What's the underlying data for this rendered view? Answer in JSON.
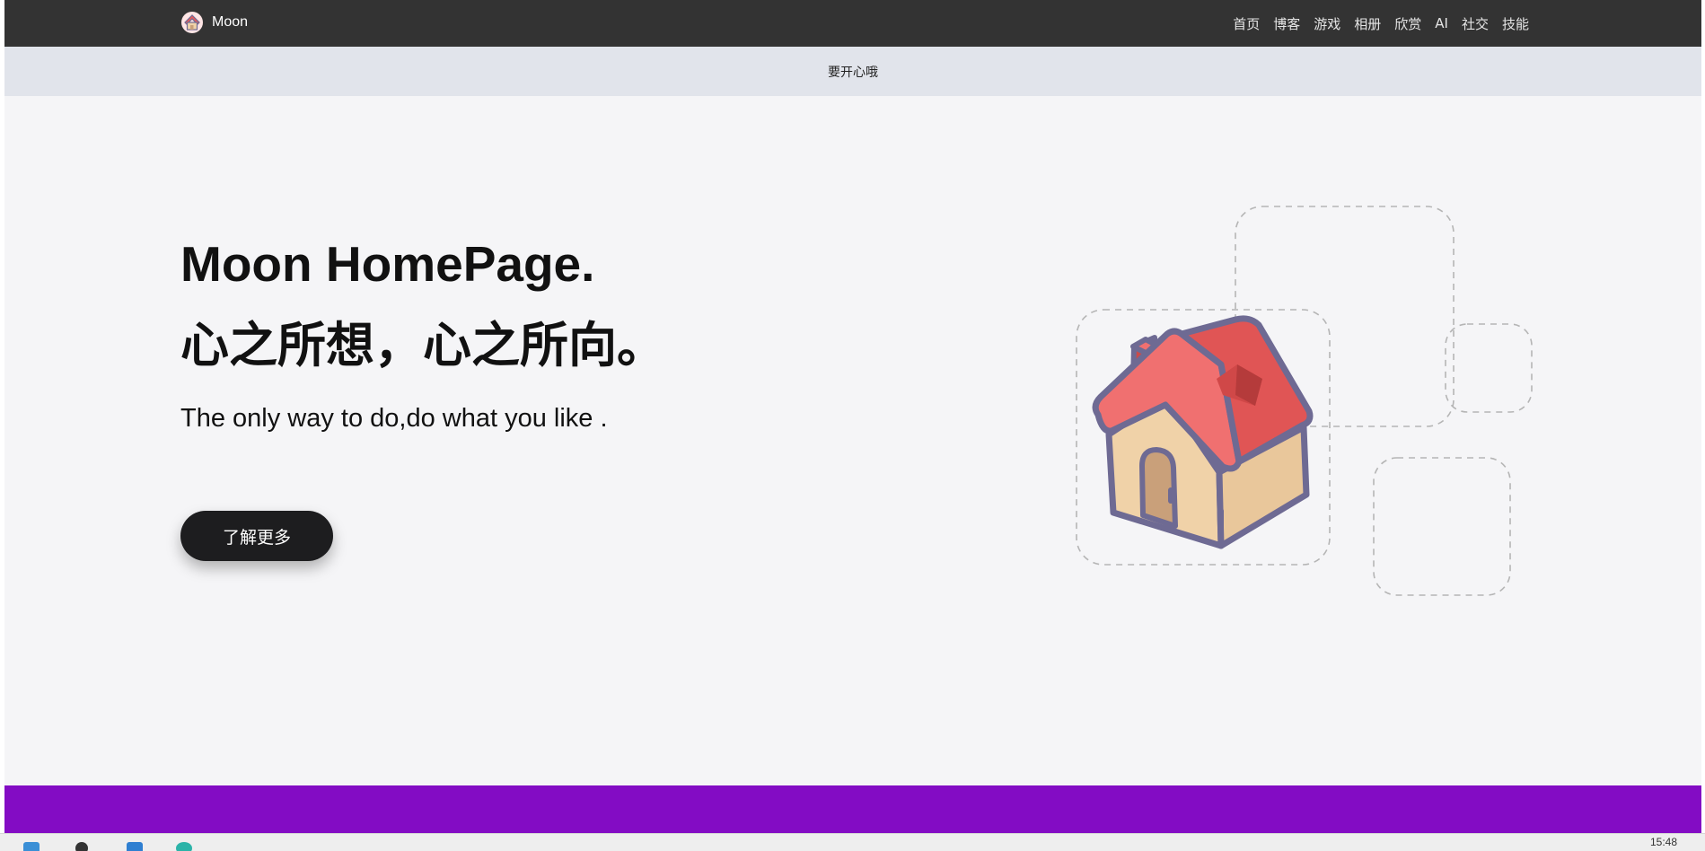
{
  "navbar": {
    "brand": "Moon",
    "links": [
      {
        "label": "首页"
      },
      {
        "label": "博客"
      },
      {
        "label": "游戏"
      },
      {
        "label": "相册"
      },
      {
        "label": "欣赏"
      },
      {
        "label": "AI"
      },
      {
        "label": "社交"
      },
      {
        "label": "技能"
      }
    ]
  },
  "announcement": "要开心哦",
  "hero": {
    "title_en": "Moon HomePage.",
    "title_cn": "心之所想，心之所向。",
    "subtitle": "The only way to do,do what you like .",
    "button_label": "了解更多"
  },
  "icons": {
    "brand_logo": "house-icon",
    "hero_image": "house-icon"
  },
  "colors": {
    "navbar_bg": "#333333",
    "announce_bg": "#e1e4eb",
    "page_bg": "#f5f5f7",
    "button_bg": "#1d1d1f",
    "footer_band": "#830cc4",
    "roof": "#e85a5a",
    "wall": "#f0d2a8",
    "outline": "#6e6a93"
  },
  "taskbar": {
    "clock": "15:48"
  }
}
